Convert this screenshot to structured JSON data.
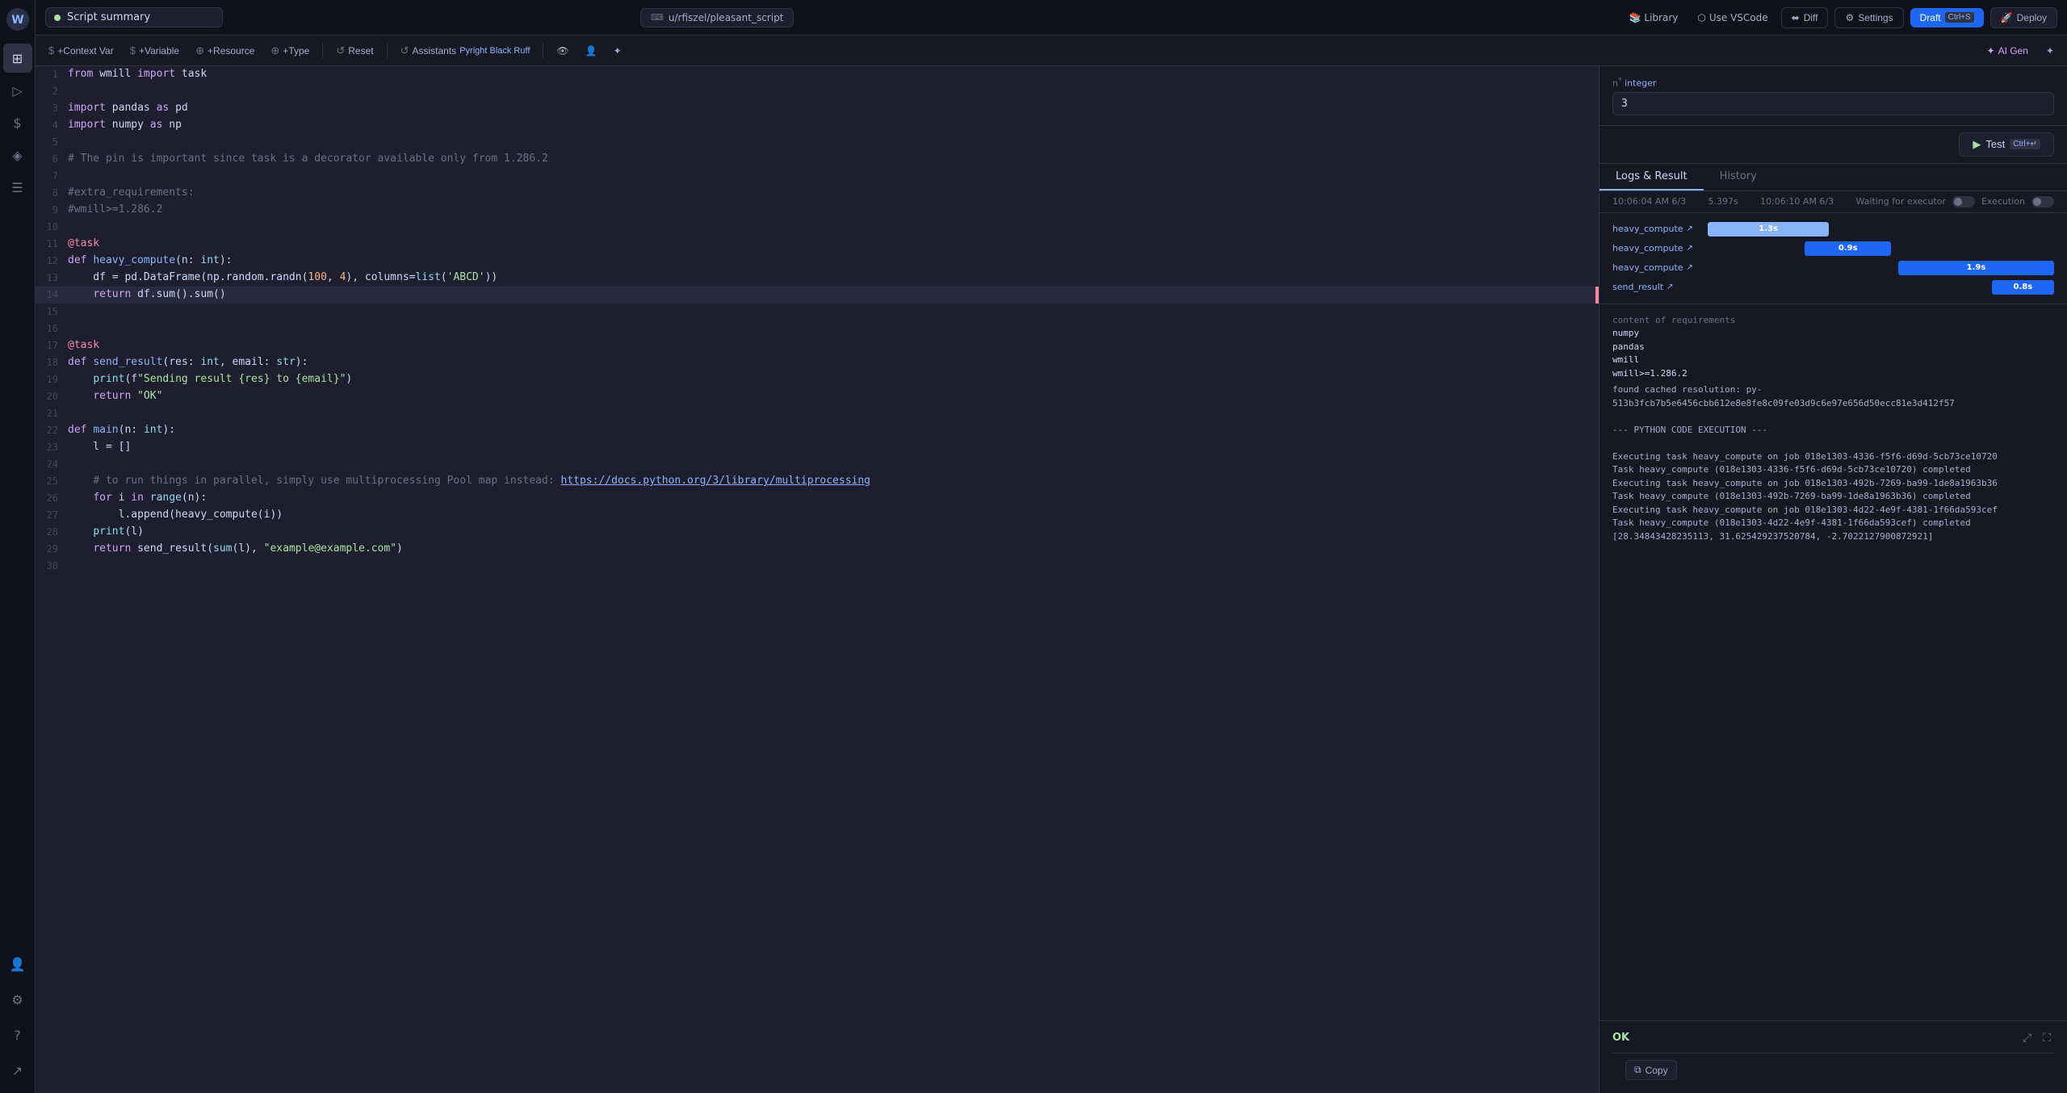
{
  "app": {
    "title": "Script summary",
    "logo": "W"
  },
  "topbar": {
    "title": "Script summary",
    "dot_color": "#a6e3a1",
    "path_icon": "⌨",
    "path": "u/rfiszel/pleasant_script",
    "diff_label": "Diff",
    "settings_label": "Settings",
    "draft_label": "Draft",
    "draft_kbd": "Ctrl+S",
    "deploy_label": "Deploy",
    "library_label": "Library",
    "vscode_label": "Use VSCode"
  },
  "toolbar": {
    "context_var": "+Context Var",
    "variable": "+Variable",
    "resource": "+Resource",
    "type": "+Type",
    "reset": "Reset",
    "assistants": "Assistants",
    "assistants_sub": "Pyright Black Ruff",
    "ai_gen": "AI Gen"
  },
  "code": {
    "lines": [
      {
        "num": 1,
        "text": "from wmill import task"
      },
      {
        "num": 2,
        "text": ""
      },
      {
        "num": 3,
        "text": "import pandas as pd"
      },
      {
        "num": 4,
        "text": "import numpy as np"
      },
      {
        "num": 5,
        "text": ""
      },
      {
        "num": 6,
        "text": "# The pin is important since task is a decorator available only from 1.286.2"
      },
      {
        "num": 7,
        "text": ""
      },
      {
        "num": 8,
        "text": "#extra_requirements:"
      },
      {
        "num": 9,
        "text": "#wmill>=1.286.2"
      },
      {
        "num": 10,
        "text": ""
      },
      {
        "num": 11,
        "text": "@task"
      },
      {
        "num": 12,
        "text": "def heavy_compute(n: int):"
      },
      {
        "num": 13,
        "text": "    df = pd.DataFrame(np.random.randn(100, 4), columns=list('ABCD'))"
      },
      {
        "num": 14,
        "text": "    return df.sum().sum()"
      },
      {
        "num": 15,
        "text": ""
      },
      {
        "num": 16,
        "text": ""
      },
      {
        "num": 17,
        "text": "@task"
      },
      {
        "num": 18,
        "text": "def send_result(res: int, email: str):"
      },
      {
        "num": 19,
        "text": "    print(f\"Sending result {res} to {email}\")"
      },
      {
        "num": 20,
        "text": "    return \"OK\""
      },
      {
        "num": 21,
        "text": ""
      },
      {
        "num": 22,
        "text": "def main(n: int):"
      },
      {
        "num": 23,
        "text": "    l = []"
      },
      {
        "num": 24,
        "text": ""
      },
      {
        "num": 25,
        "text": "    # to run things in parallel, simply use multiprocessing Pool map instead: https://docs.python.org/3/library/multiprocessing"
      },
      {
        "num": 26,
        "text": "    for i in range(n):"
      },
      {
        "num": 27,
        "text": "        l.append(heavy_compute(i))"
      },
      {
        "num": 28,
        "text": "    print(l)"
      },
      {
        "num": 29,
        "text": "    return send_result(sum(l), \"example@example.com\")"
      },
      {
        "num": 30,
        "text": ""
      }
    ]
  },
  "right_panel": {
    "input_label_prefix": "n",
    "input_type": "integer",
    "input_value": "3",
    "test_label": "Test",
    "test_kbd": "Ctrl+↵",
    "tabs": [
      "Logs & Result",
      "History"
    ],
    "active_tab": "Logs & Result",
    "exec_time1": "10:06:04 AM 6/3",
    "exec_duration": "5.397s",
    "exec_time2": "10:06:10 AM 6/3",
    "waiting_label": "Waiting for executor",
    "execution_label": "Execution",
    "timeline": [
      {
        "label": "heavy_compute",
        "duration": "1.3s",
        "offset_pct": 0,
        "width_pct": 30,
        "color": "#89b4fa"
      },
      {
        "label": "heavy_compute",
        "duration": "0.9s",
        "offset_pct": 25,
        "width_pct": 22,
        "color": "#1e66f5"
      },
      {
        "label": "heavy_compute",
        "duration": "1.9s",
        "offset_pct": 50,
        "width_pct": 40,
        "color": "#1e66f5"
      },
      {
        "label": "send_result",
        "duration": "0.8s",
        "offset_pct": 75,
        "width_pct": 20,
        "color": "#1e66f5"
      }
    ],
    "requirements": [
      "numpy",
      "pandas",
      "wmill",
      "wmill>=1.286.2"
    ],
    "log_lines": [
      "found cached resolution: py-513b3fcb7b5e6456cbb612e8e8fe8c09fe03d9c6e97e656d50ecc81e3d412f57",
      "",
      "--- PYTHON CODE EXECUTION ---",
      "",
      "Executing task heavy_compute on job 018e1303-4336-f5f6-d69d-5cb73ce10720",
      "Task heavy_compute (018e1303-4336-f5f6-d69d-5cb73ce10720) completed",
      "Executing task heavy_compute on job 018e1303-492b-7269-ba99-1de8a1963b36",
      "Task heavy_compute (018e1303-492b-7269-ba99-1de8a1963b36) completed",
      "Executing task heavy_compute on job 018e1303-4d22-4e9f-4381-1f66da593cef",
      "Task heavy_compute (018e1303-4d22-4e9f-4381-1f66da593cef) completed",
      "[28.34843428235113, 31.625429237520784, -2.7022127900872921]"
    ],
    "result_ok": "OK",
    "copy_label": "Copy"
  },
  "sidebar": {
    "icons": [
      "⊞",
      "▷",
      "$",
      "♦",
      "☰"
    ],
    "bottom_icons": [
      "⚙",
      "👤",
      "?",
      "↗"
    ]
  }
}
